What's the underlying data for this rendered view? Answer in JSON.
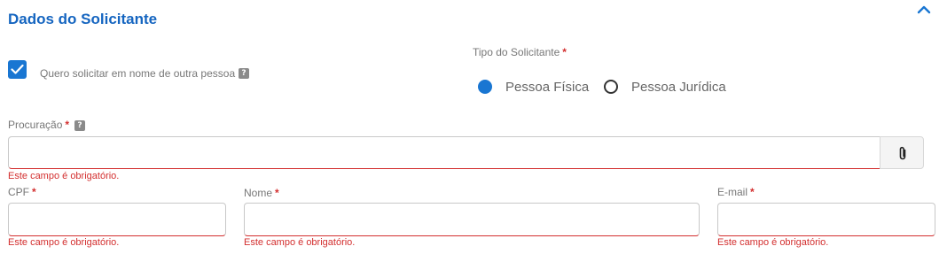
{
  "section": {
    "title": "Dados do Solicitante"
  },
  "represent": {
    "label": "Quero solicitar em nome de outra pessoa",
    "checked": true
  },
  "tipo": {
    "label": "Tipo do Solicitante",
    "required_mark": "*",
    "options": [
      {
        "label": "Pessoa Física",
        "selected": true
      },
      {
        "label": "Pessoa Jurídica",
        "selected": false
      }
    ]
  },
  "procuracao": {
    "label": "Procuração",
    "required_mark": "*",
    "value": "",
    "error": "Este campo é obrigatório."
  },
  "cpf": {
    "label": "CPF",
    "required_mark": "*",
    "value": "",
    "error": "Este campo é obrigatório."
  },
  "nome": {
    "label": "Nome",
    "required_mark": "*",
    "value": "",
    "error": "Este campo é obrigatório."
  },
  "email": {
    "label": "E-mail",
    "required_mark": "*",
    "value": "",
    "error": "Este campo é obrigatório."
  },
  "help_icon_glyph": "?",
  "colors": {
    "accent": "#1976d2",
    "title": "#1565c0",
    "error": "#d32f2f"
  },
  "icons": {
    "collapse": "chevron-up-icon",
    "attach": "paperclip-icon",
    "help": "help-icon",
    "check": "checkmark-icon"
  }
}
